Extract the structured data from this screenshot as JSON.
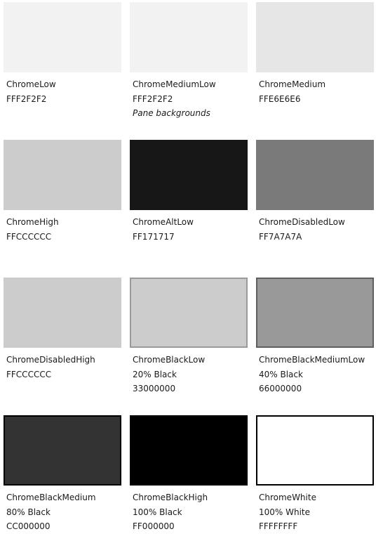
{
  "swatches": [
    {
      "name": "ChromeLow",
      "lines": [
        "FFF2F2F2"
      ],
      "color": "#f2f2f2",
      "border": "none"
    },
    {
      "name": "ChromeMediumLow",
      "lines": [
        "FFF2F2F2"
      ],
      "note": "Pane backgrounds",
      "color": "#f2f2f2",
      "border": "none"
    },
    {
      "name": "ChromeMedium",
      "lines": [
        "FFE6E6E6"
      ],
      "color": "#e6e6e6",
      "border": "none"
    },
    {
      "name": "ChromeHigh",
      "lines": [
        "FFCCCCCC"
      ],
      "color": "#cccccc",
      "border": "none"
    },
    {
      "name": "ChromeAltLow",
      "lines": [
        "FF171717"
      ],
      "color": "#171717",
      "border": "none"
    },
    {
      "name": "ChromeDisabledLow",
      "lines": [
        "FF7A7A7A"
      ],
      "color": "#7a7a7a",
      "border": "none"
    },
    {
      "name": "ChromeDisabledHigh",
      "lines": [
        "FFCCCCCC"
      ],
      "color": "#cccccc",
      "border": "none"
    },
    {
      "name": "ChromeBlackLow",
      "lines": [
        "20% Black",
        "33000000"
      ],
      "color": "#cccccc",
      "border": "light"
    },
    {
      "name": "ChromeBlackMediumLow",
      "lines": [
        "40% Black",
        "66000000"
      ],
      "color": "#999999",
      "border": "mid"
    },
    {
      "name": "ChromeBlackMedium",
      "lines": [
        "80% Black",
        "CC000000"
      ],
      "color": "#333333",
      "border": "dark"
    },
    {
      "name": "ChromeBlackHigh",
      "lines": [
        "100% Black",
        "FF000000"
      ],
      "color": "#000000",
      "border": "dark"
    },
    {
      "name": "ChromeWhite",
      "lines": [
        "100% White",
        "FFFFFFFF"
      ],
      "color": "#ffffff",
      "border": "dark"
    }
  ]
}
